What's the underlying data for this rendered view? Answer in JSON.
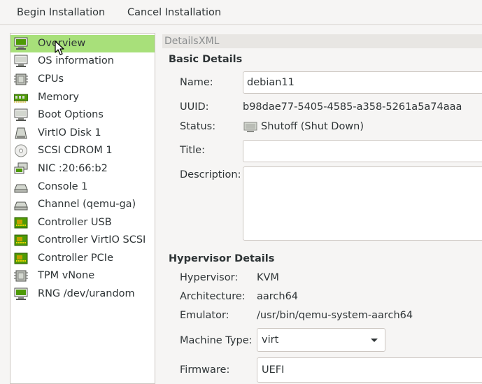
{
  "toolbar": {
    "begin_label": "Begin Installation",
    "cancel_label": "Cancel Installation"
  },
  "sidebar": {
    "items": [
      {
        "label": "Overview",
        "icon": "monitor-icon",
        "selected": true
      },
      {
        "label": "OS information",
        "icon": "monitor-icon"
      },
      {
        "label": "CPUs",
        "icon": "cpu-icon"
      },
      {
        "label": "Memory",
        "icon": "memory-icon"
      },
      {
        "label": "Boot Options",
        "icon": "monitor-icon"
      },
      {
        "label": "VirtIO Disk 1",
        "icon": "disk-icon"
      },
      {
        "label": "SCSI CDROM 1",
        "icon": "cdrom-icon"
      },
      {
        "label": "NIC :20:66:b2",
        "icon": "network-icon"
      },
      {
        "label": "Console 1",
        "icon": "console-icon"
      },
      {
        "label": "Channel (qemu-ga)",
        "icon": "console-icon"
      },
      {
        "label": "Controller USB",
        "icon": "controller-icon"
      },
      {
        "label": "Controller VirtIO SCSI",
        "icon": "controller-icon"
      },
      {
        "label": "Controller PCIe",
        "icon": "controller-icon"
      },
      {
        "label": "TPM vNone",
        "icon": "cpu-icon"
      },
      {
        "label": "RNG /dev/urandom",
        "icon": "monitor-icon"
      }
    ]
  },
  "tabs": {
    "details": "Details",
    "xml": "XML",
    "active": "Details"
  },
  "basic": {
    "title": "Basic Details",
    "name_label": "Name:",
    "name_value": "debian11",
    "uuid_label": "UUID:",
    "uuid_value": "b98dae77-5405-4585-a358-5261a5a74aaa",
    "status_label": "Status:",
    "status_value": "Shutoff (Shut Down)",
    "title_label": "Title:",
    "title_value": "",
    "description_label": "Description:",
    "description_value": ""
  },
  "hypervisor": {
    "title": "Hypervisor Details",
    "hypervisor_label": "Hypervisor:",
    "hypervisor_value": "KVM",
    "arch_label": "Architecture:",
    "arch_value": "aarch64",
    "emulator_label": "Emulator:",
    "emulator_value": "/usr/bin/qemu-system-aarch64",
    "machine_label": "Machine Type:",
    "machine_value": "virt",
    "firmware_label": "Firmware:",
    "firmware_value": "UEFI"
  },
  "colors": {
    "selected_bg": "#a8e07a",
    "window_bg": "#f6f5f4",
    "border": "#cdc7c2"
  }
}
